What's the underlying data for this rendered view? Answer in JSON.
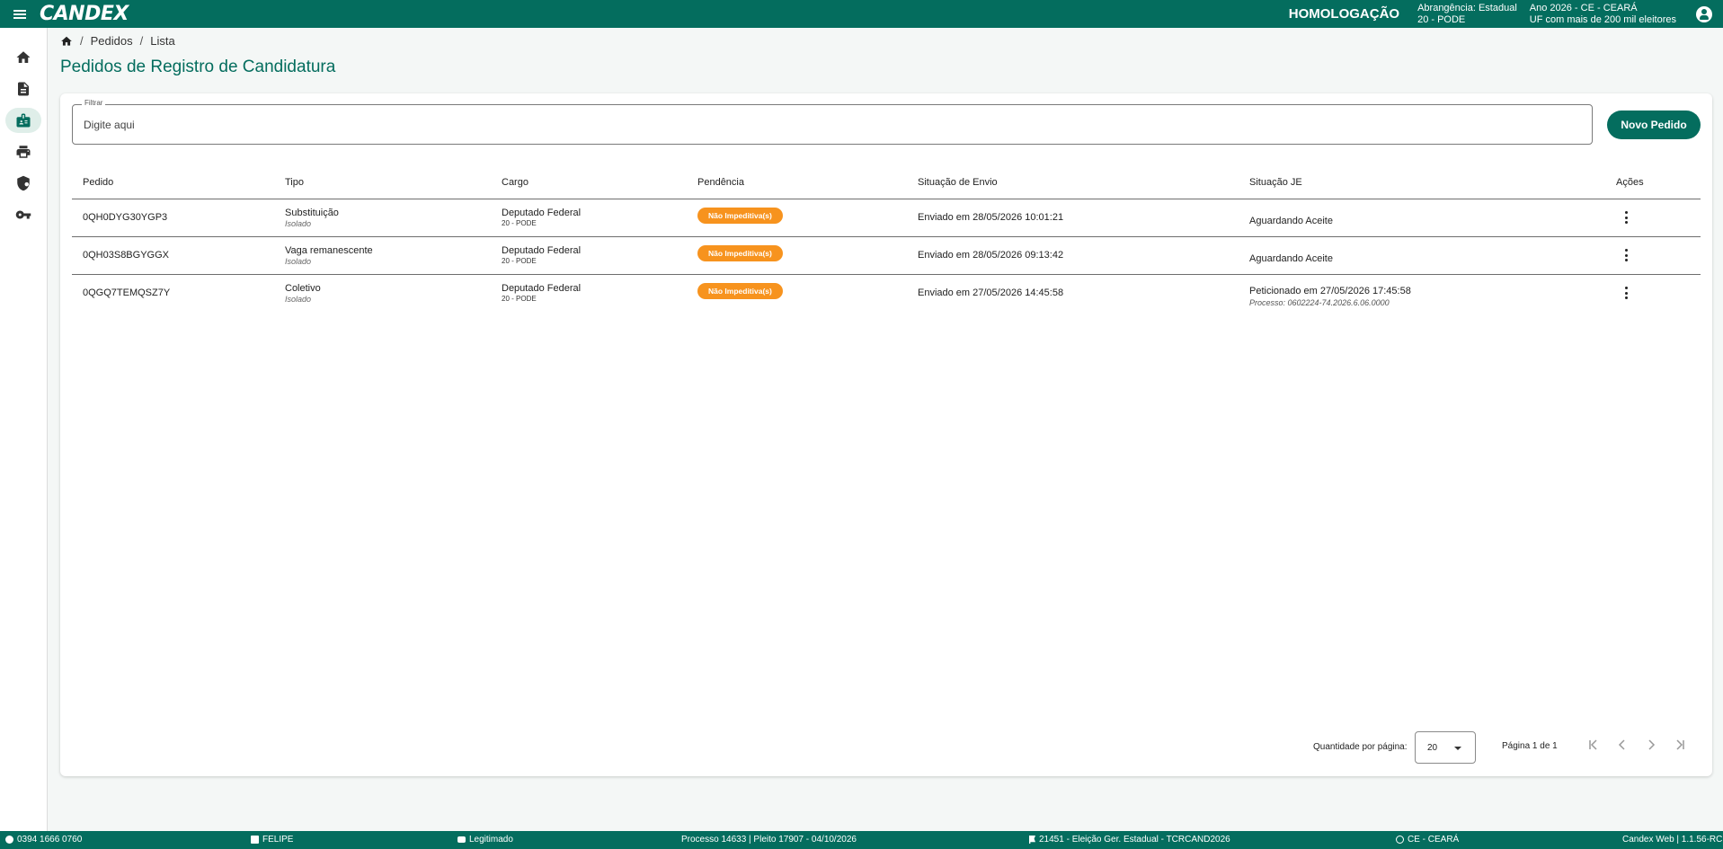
{
  "header": {
    "logo": "CANDEX",
    "environment": "HOMOLOGAÇÃO",
    "abrangencia_line1": "Abrangência: Estadual",
    "abrangencia_line2": "20 - PODE",
    "ano_line1": "Ano 2026 - CE - CEARÁ",
    "ano_line2": "UF com mais de 200 mil eleitores"
  },
  "sidebar": {
    "items": [
      {
        "icon": "home-icon"
      },
      {
        "icon": "document-icon"
      },
      {
        "icon": "badge-icon",
        "active": true
      },
      {
        "icon": "printer-icon"
      },
      {
        "icon": "shield-icon"
      },
      {
        "icon": "key-icon"
      }
    ]
  },
  "breadcrumb": {
    "items": [
      "Pedidos",
      "Lista"
    ]
  },
  "page": {
    "title": "Pedidos de Registro de Candidatura"
  },
  "filter": {
    "label": "Filtrar",
    "placeholder": "Digite aqui",
    "value": ""
  },
  "actions": {
    "novo_pedido": "Novo Pedido"
  },
  "table": {
    "headers": [
      "Pedido",
      "Tipo",
      "Cargo",
      "Pendência",
      "Situação de Envio",
      "Situação JE",
      "Ações"
    ],
    "rows": [
      {
        "pedido": "0QH0DYG30YGP3",
        "tipo": "Substituição",
        "tipo_sub": "Isolado",
        "cargo": "Deputado Federal",
        "cargo_sub": "20 - PODE",
        "pendencia": "Não Impeditiva(s)",
        "envio": "Enviado em 28/05/2026 10:01:21",
        "je": "Aguardando Aceite",
        "je_sub": ""
      },
      {
        "pedido": "0QH03S8BGYGGX",
        "tipo": "Vaga remanescente",
        "tipo_sub": "Isolado",
        "cargo": "Deputado Federal",
        "cargo_sub": "20 - PODE",
        "pendencia": "Não Impeditiva(s)",
        "envio": "Enviado em 28/05/2026 09:13:42",
        "je": "Aguardando Aceite",
        "je_sub": ""
      },
      {
        "pedido": "0QGQ7TEMQSZ7Y",
        "tipo": "Coletivo",
        "tipo_sub": "Isolado",
        "cargo": "Deputado Federal",
        "cargo_sub": "20 - PODE",
        "pendencia": "Não Impeditiva(s)",
        "envio": "Enviado em 27/05/2026 14:45:58",
        "je": "Peticionado em 27/05/2026 17:45:58",
        "je_sub": "Processo: 0602224-74.2026.6.06.0000"
      }
    ]
  },
  "paginator": {
    "per_page_label": "Quantidade por página:",
    "per_page_value": "20",
    "page_info": "Página 1 de 1"
  },
  "footer": {
    "phone": "0394 1666 0760",
    "user": "FELIPE",
    "role": "Legitimado",
    "processo": "Processo 14633 | Pleito 17907 - 04/10/2026",
    "eleicao": "21451 - Eleição Ger. Estadual - TCRCAND2026",
    "uf": "CE - CEARÁ",
    "version": "Candex Web | 1.1.56-RC"
  },
  "colors": {
    "primary": "#046d5e",
    "badge": "#f7931e"
  }
}
